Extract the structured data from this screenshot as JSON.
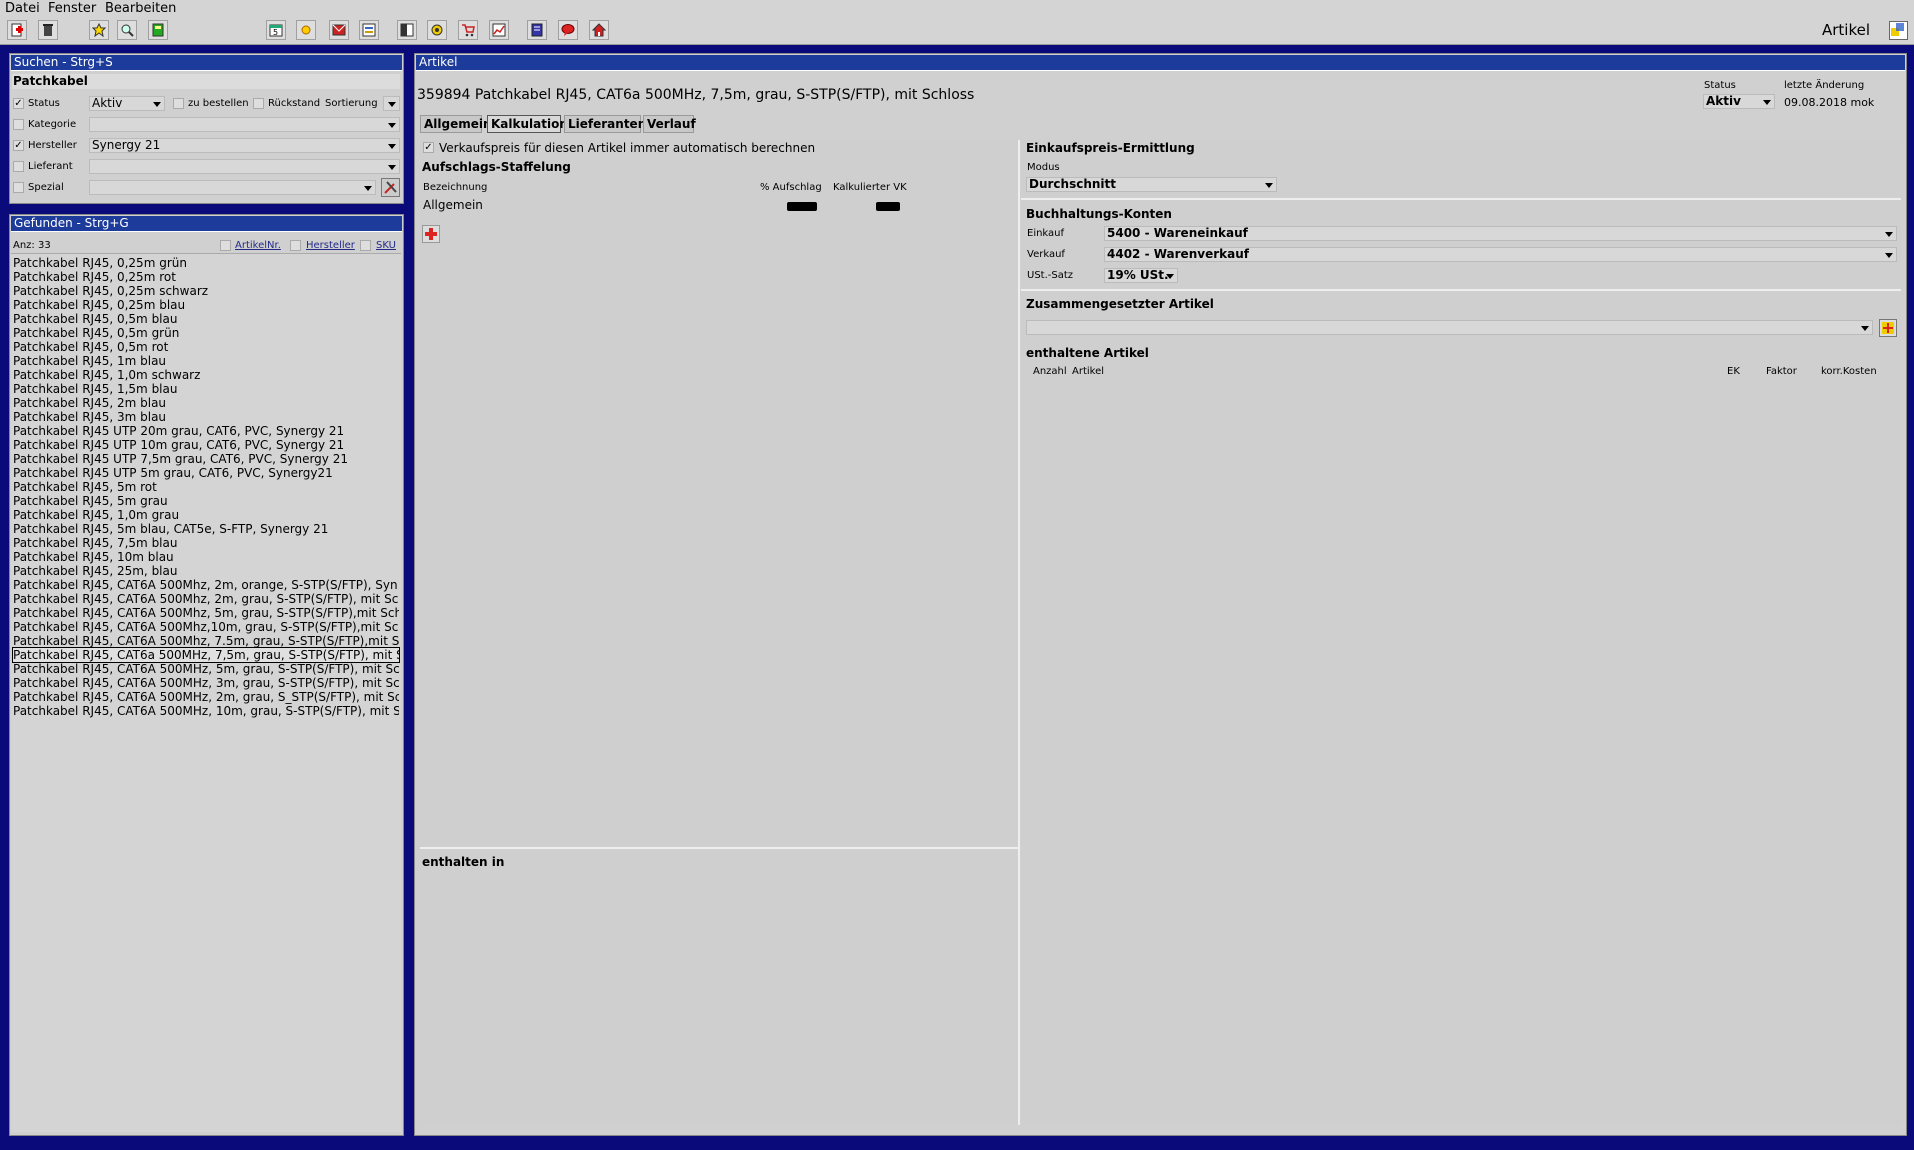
{
  "menu": [
    "Datei",
    "Fenster",
    "Bearbeiten"
  ],
  "app_title": "Artikel",
  "search": {
    "header": "Suchen - Strg+S",
    "query": "Patchkabel",
    "status_label": "Status",
    "status_value": "Aktiv",
    "zu_bestellen_label": "zu bestellen",
    "rueckstand_label": "Rückstand",
    "sortierung_label": "Sortierung",
    "kategorie_label": "Kategorie",
    "hersteller_label": "Hersteller",
    "hersteller_value": "Synergy 21",
    "lieferant_label": "Lieferant",
    "spezial_label": "Spezial"
  },
  "found": {
    "header": "Gefunden - Strg+G",
    "count": "Anz: 33",
    "col_artikelnr": "ArtikelNr.",
    "col_hersteller": "Hersteller",
    "col_sku": "SKU",
    "items": [
      "Patchkabel RJ45, 0,25m grün",
      "Patchkabel RJ45, 0,25m rot",
      "Patchkabel RJ45, 0,25m schwarz",
      "Patchkabel RJ45, 0,25m blau",
      "Patchkabel RJ45, 0,5m blau",
      "Patchkabel RJ45, 0,5m grün",
      "Patchkabel RJ45, 0,5m rot",
      "Patchkabel RJ45, 1m blau",
      "Patchkabel RJ45, 1,0m schwarz",
      "Patchkabel RJ45, 1,5m blau",
      "Patchkabel RJ45, 2m blau",
      "Patchkabel RJ45, 3m blau",
      "Patchkabel RJ45 UTP 20m grau, CAT6, PVC, Synergy 21",
      "Patchkabel RJ45 UTP 10m grau, CAT6, PVC, Synergy 21",
      "Patchkabel RJ45 UTP 7,5m grau, CAT6, PVC, Synergy 21",
      "Patchkabel RJ45 UTP 5m grau, CAT6, PVC, Synergy21",
      "Patchkabel RJ45, 5m rot",
      "Patchkabel RJ45, 5m grau",
      "Patchkabel RJ45, 1,0m grau",
      "Patchkabel RJ45, 5m blau, CAT5e, S-FTP, Synergy 21",
      "Patchkabel RJ45, 7,5m blau",
      "Patchkabel RJ45, 10m blau",
      "Patchkabel RJ45, 25m, blau",
      "Patchkabel RJ45, CAT6A 500Mhz, 2m, orange, S-STP(S/FTP), Syn",
      "Patchkabel RJ45, CAT6A 500Mhz, 2m, grau, S-STP(S/FTP), mit Sc",
      "Patchkabel RJ45, CAT6A 500Mhz, 5m, grau, S-STP(S/FTP),mit Sch",
      "Patchkabel RJ45, CAT6A 500Mhz,10m, grau, S-STP(S/FTP),mit Sc",
      "Patchkabel RJ45, CAT6A 500Mhz, 7.5m, grau, S-STP(S/FTP),mit S",
      "Patchkabel RJ45, CAT6a 500MHz, 7,5m, grau, S-STP(S/FTP), mit S",
      "Patchkabel RJ45, CAT6A 500MHz, 5m, grau, S-STP(S/FTP), mit Sc",
      "Patchkabel RJ45, CAT6A 500MHz, 3m, grau, S-STP(S/FTP), mit Sc",
      "Patchkabel RJ45, CAT6A 500MHz, 2m, grau, S_STP(S/FTP), mit Sc",
      "Patchkabel RJ45, CAT6A 500MHz, 10m, grau, S-STP(S/FTP), mit S"
    ],
    "selected_index": 28
  },
  "article": {
    "header": "Artikel",
    "title": "359894 Patchkabel RJ45, CAT6a 500MHz, 7,5m, grau, S-STP(S/FTP), mit Schloss",
    "status_label": "Status",
    "status_value": "Aktiv",
    "last_change_label": "letzte Änderung",
    "last_change_value": "09.08.2018 mok",
    "tabs": [
      "Allgemein",
      "Kalkulation",
      "Lieferanten",
      "Verlauf"
    ],
    "active_tab": "Kalkulation",
    "auto_calc_label": "Verkaufspreis für diesen Artikel immer automatisch berechnen",
    "staffelung_title": "Aufschlags-Staffelung",
    "col_bezeichnung": "Bezeichnung",
    "col_aufschlag": "% Aufschlag",
    "col_vk": "Kalkulierter VK",
    "row_allgemein": "Allgemein",
    "enthalten_in_title": "enthalten in",
    "ek_title": "Einkaufspreis-Ermittlung",
    "modus_label": "Modus",
    "modus_value": "Durchschnitt",
    "konten_title": "Buchhaltungs-Konten",
    "einkauf_label": "Einkauf",
    "einkauf_value": "5400 - Wareneinkauf",
    "verkauf_label": "Verkauf",
    "verkauf_value": "4402 - Warenverkauf",
    "ust_label": "USt.-Satz",
    "ust_value": "19% USt.",
    "zusammen_title": "Zusammengesetzter Artikel",
    "enthaltene_title": "enthaltene Artikel",
    "col_anzahl": "Anzahl",
    "col_artikel": "Artikel",
    "col_ek": "EK",
    "col_faktor": "Faktor",
    "col_korr": "korr.Kosten"
  },
  "colors": {
    "background": "#0a0a7a",
    "panel_header": "#1c3b9a",
    "panel": "#d0d0d0"
  }
}
